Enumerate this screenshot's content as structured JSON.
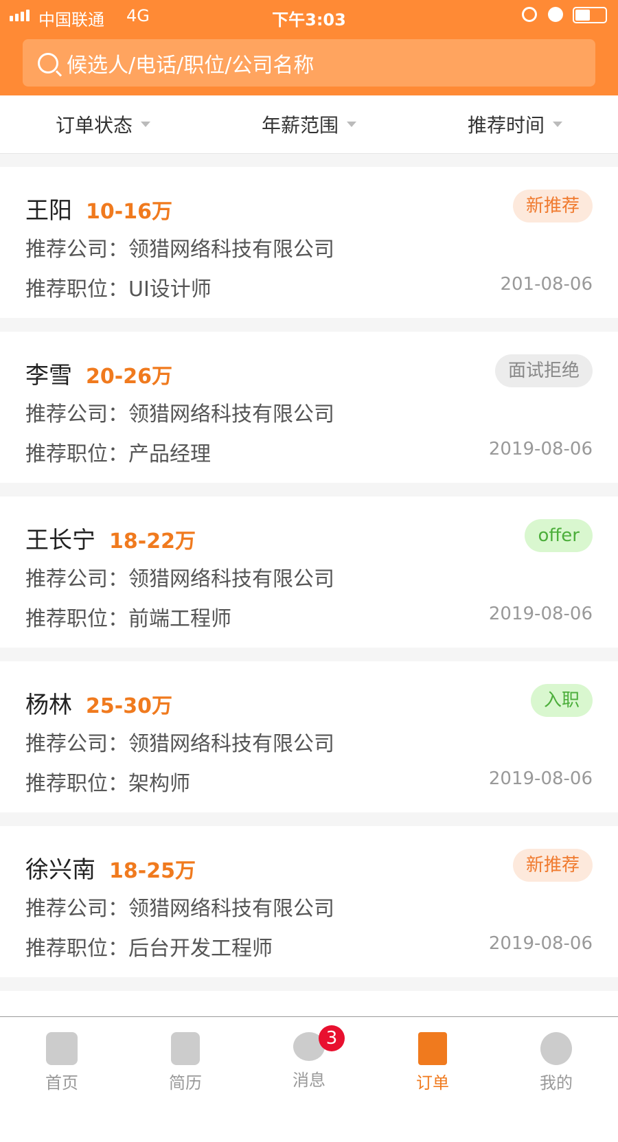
{
  "status_bar": {
    "carrier": "中国联通",
    "network": "4G",
    "time": "下午3:03"
  },
  "search": {
    "placeholder": "候选人/电话/职位/公司名称"
  },
  "filters": [
    {
      "label": "订单状态"
    },
    {
      "label": "年薪范围"
    },
    {
      "label": "推荐时间"
    }
  ],
  "orders": [
    {
      "name": "王阳",
      "salary": "10-16万",
      "status": "新推荐",
      "company": "推荐公司：领猎网络科技有限公司",
      "position": "推荐职位：UI设计师",
      "date": "201-08-06",
      "badge_bg": "#fde9dc",
      "badge_color": "#f07a2e"
    },
    {
      "name": "李雪",
      "salary": "20-26万",
      "status": "面试拒绝",
      "company": "推荐公司：领猎网络科技有限公司",
      "position": "推荐职位：产品经理",
      "date": "2019-08-06",
      "badge_bg": "#ececec",
      "badge_color": "#888888"
    },
    {
      "name": "王长宁",
      "salary": "18-22万",
      "status": "offer",
      "company": "推荐公司：领猎网络科技有限公司",
      "position": "推荐职位：前端工程师",
      "date": "2019-08-06",
      "badge_bg": "#d9f7cf",
      "badge_color": "#4cae3b"
    },
    {
      "name": "杨林",
      "salary": "25-30万",
      "status": "入职",
      "company": "推荐公司：领猎网络科技有限公司",
      "position": "推荐职位：架构师",
      "date": "2019-08-06",
      "badge_bg": "#d9f7cf",
      "badge_color": "#4cae3b"
    },
    {
      "name": "徐兴南",
      "salary": "18-25万",
      "status": "新推荐",
      "company": "推荐公司：领猎网络科技有限公司",
      "position": "推荐职位：后台开发工程师",
      "date": "2019-08-06",
      "badge_bg": "#fde9dc",
      "badge_color": "#f07a2e"
    }
  ],
  "tabbar": [
    {
      "label": "首页",
      "icon": "owl-icon"
    },
    {
      "label": "简历",
      "icon": "document-icon"
    },
    {
      "label": "消息",
      "icon": "chat-icon",
      "badge": "3"
    },
    {
      "label": "订单",
      "icon": "order-icon",
      "active": true
    },
    {
      "label": "我的",
      "icon": "user-icon"
    }
  ],
  "colors": {
    "brand": "#ff8a35",
    "accent": "#f07a1e"
  }
}
